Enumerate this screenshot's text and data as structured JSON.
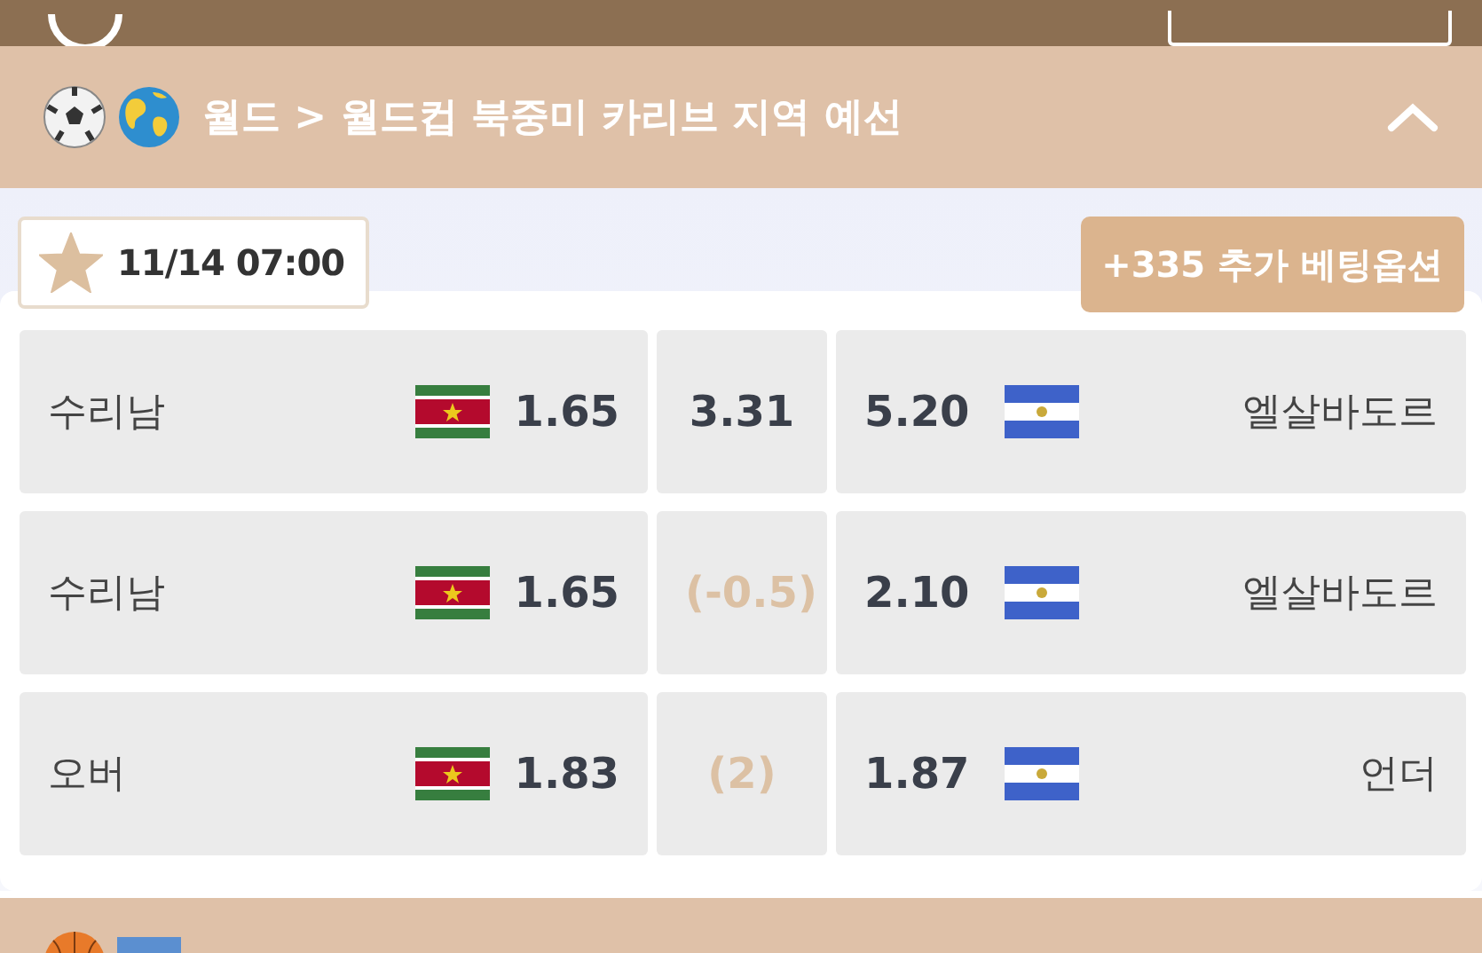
{
  "league": {
    "path": "월드 > 월드컵 북중미 카리브 지역 예선",
    "expanded": true
  },
  "match": {
    "time": "11/14 07:00",
    "favorite": true,
    "more_button": "+335 추가 베팅옵션",
    "markets": [
      {
        "home": "수리남",
        "home_odds": "1.65",
        "middle": "3.31",
        "kind": "draw",
        "away_odds": "5.20",
        "away": "엘살바도르"
      },
      {
        "home": "수리남",
        "home_odds": "1.65",
        "middle": "(-0.5)",
        "kind": "line",
        "away_odds": "2.10",
        "away": "엘살바도르"
      },
      {
        "home": "오버",
        "home_odds": "1.83",
        "middle": "(2)",
        "kind": "line",
        "away_odds": "1.87",
        "away": "언더"
      }
    ]
  }
}
